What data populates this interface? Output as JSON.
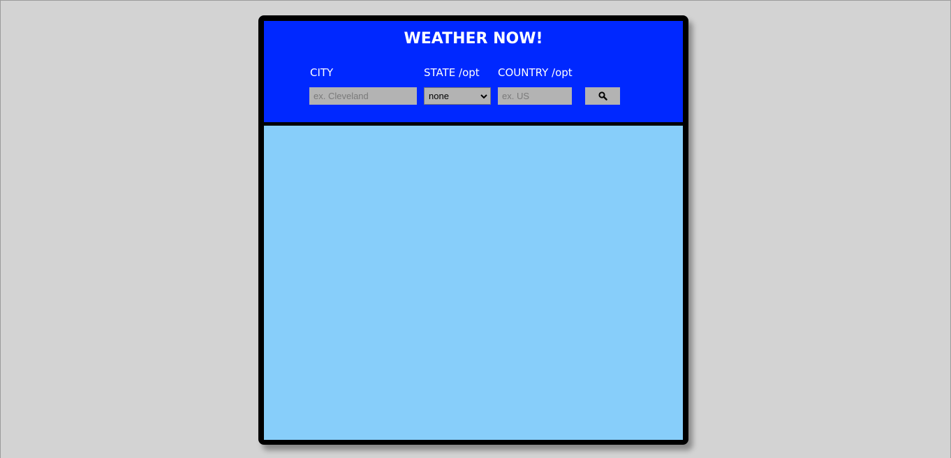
{
  "app": {
    "title": "WEATHER NOW!"
  },
  "search": {
    "city_label": "CITY",
    "city_placeholder": "ex. Cleveland",
    "city_value": "",
    "state_label": "STATE /opt",
    "state_selected": "none",
    "country_label": "COUNTRY /opt",
    "country_placeholder": "ex. US",
    "country_value": "",
    "search_icon": "search-icon"
  },
  "colors": {
    "page_background": "#d3d3d3",
    "header_background": "#0028ff",
    "content_background": "#87cefa",
    "card_border": "#000000",
    "field_background": "#b3b3b3"
  }
}
